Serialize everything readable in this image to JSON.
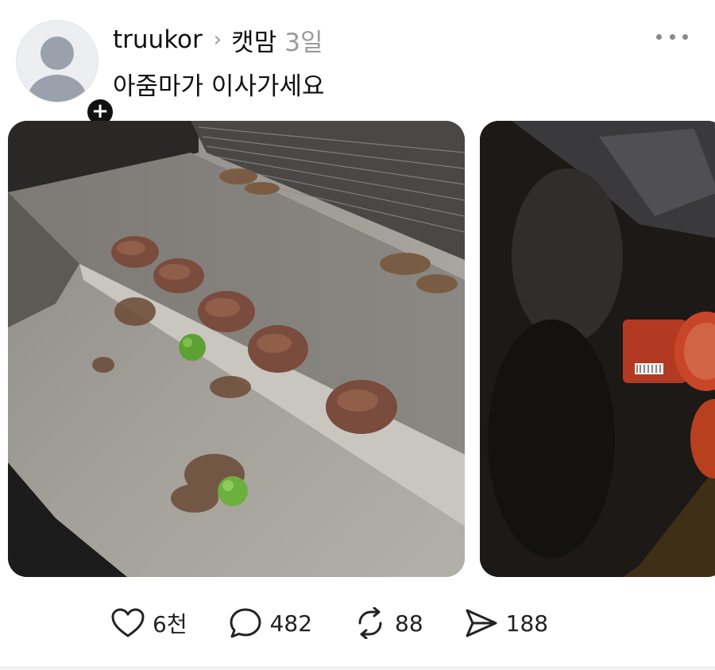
{
  "post": {
    "username": "truukor",
    "community": "캣맘",
    "timestamp": "3일",
    "text": "아줌마가 이사가세요",
    "avatar_icon": "default-user-avatar-icon",
    "follow_icon": "plus-icon",
    "follow_symbol": "+",
    "more_icon": "more-horizontal-icon"
  },
  "media": {
    "count_visible": 2,
    "items": [
      {
        "type": "photo"
      },
      {
        "type": "photo"
      }
    ]
  },
  "actions": {
    "like_count": "6천",
    "comment_count": "482",
    "repost_count": "88",
    "share_count": "188"
  },
  "colors": {
    "text": "#111111",
    "muted": "#9a9a9a",
    "badge": "#111111"
  }
}
